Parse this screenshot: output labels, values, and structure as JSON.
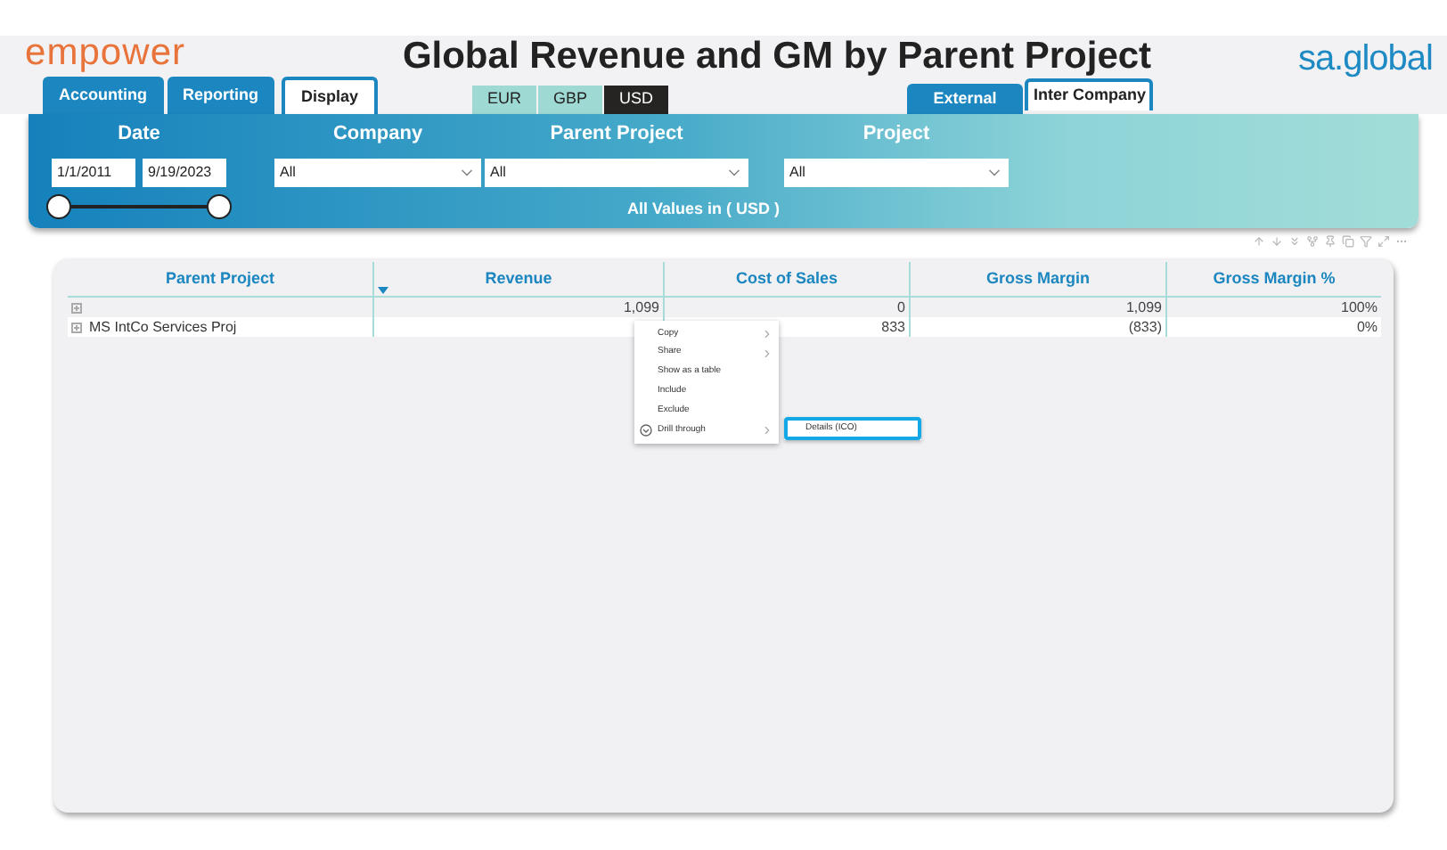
{
  "header": {
    "logo": "empower",
    "title": "Global Revenue and GM by Parent Project",
    "brand": "sa.global"
  },
  "view_tabs": [
    {
      "label": "Accounting",
      "selected": true
    },
    {
      "label": "Reporting",
      "selected": true
    },
    {
      "label": "Display",
      "selected": false
    }
  ],
  "currency_buttons": [
    {
      "label": "EUR",
      "selected": false
    },
    {
      "label": "GBP",
      "selected": false
    },
    {
      "label": "USD",
      "selected": true
    }
  ],
  "scope_tabs": [
    {
      "label": "External",
      "selected": true
    },
    {
      "label": "Inter Company",
      "selected": false
    }
  ],
  "filters": {
    "date": {
      "label": "Date",
      "start": "1/1/2011",
      "end": "9/19/2023",
      "level": 1
    },
    "dropdowns": [
      {
        "label": "Company",
        "value": "All"
      },
      {
        "label": "Parent Project",
        "value": "All"
      },
      {
        "label": "Project",
        "value": "All"
      }
    ],
    "note": "All Values in ( USD )"
  },
  "table": {
    "columns": [
      "Parent Project",
      "Revenue",
      "Cost of Sales",
      "Gross Margin",
      "Gross Margin %"
    ],
    "rows": [
      [
        "",
        "1,099",
        "0",
        "1,099",
        "100%"
      ],
      [
        "MS IntCo Services Proj",
        "",
        "833",
        "(833)",
        "0%"
      ]
    ]
  },
  "context_menu": {
    "items": [
      {
        "label": "Copy",
        "submenu": true,
        "icon": false
      },
      {
        "label": "Share",
        "submenu": true,
        "icon": false
      },
      {
        "label": "Show as a table",
        "submenu": false,
        "icon": false
      },
      {
        "label": "Include",
        "submenu": false,
        "icon": false
      },
      {
        "label": "Exclude",
        "submenu": false,
        "icon": false
      },
      {
        "label": "Drill through",
        "submenu": true,
        "icon": true
      }
    ],
    "submenu": [
      {
        "label": "Details (ICO)",
        "selected": true
      }
    ]
  }
}
